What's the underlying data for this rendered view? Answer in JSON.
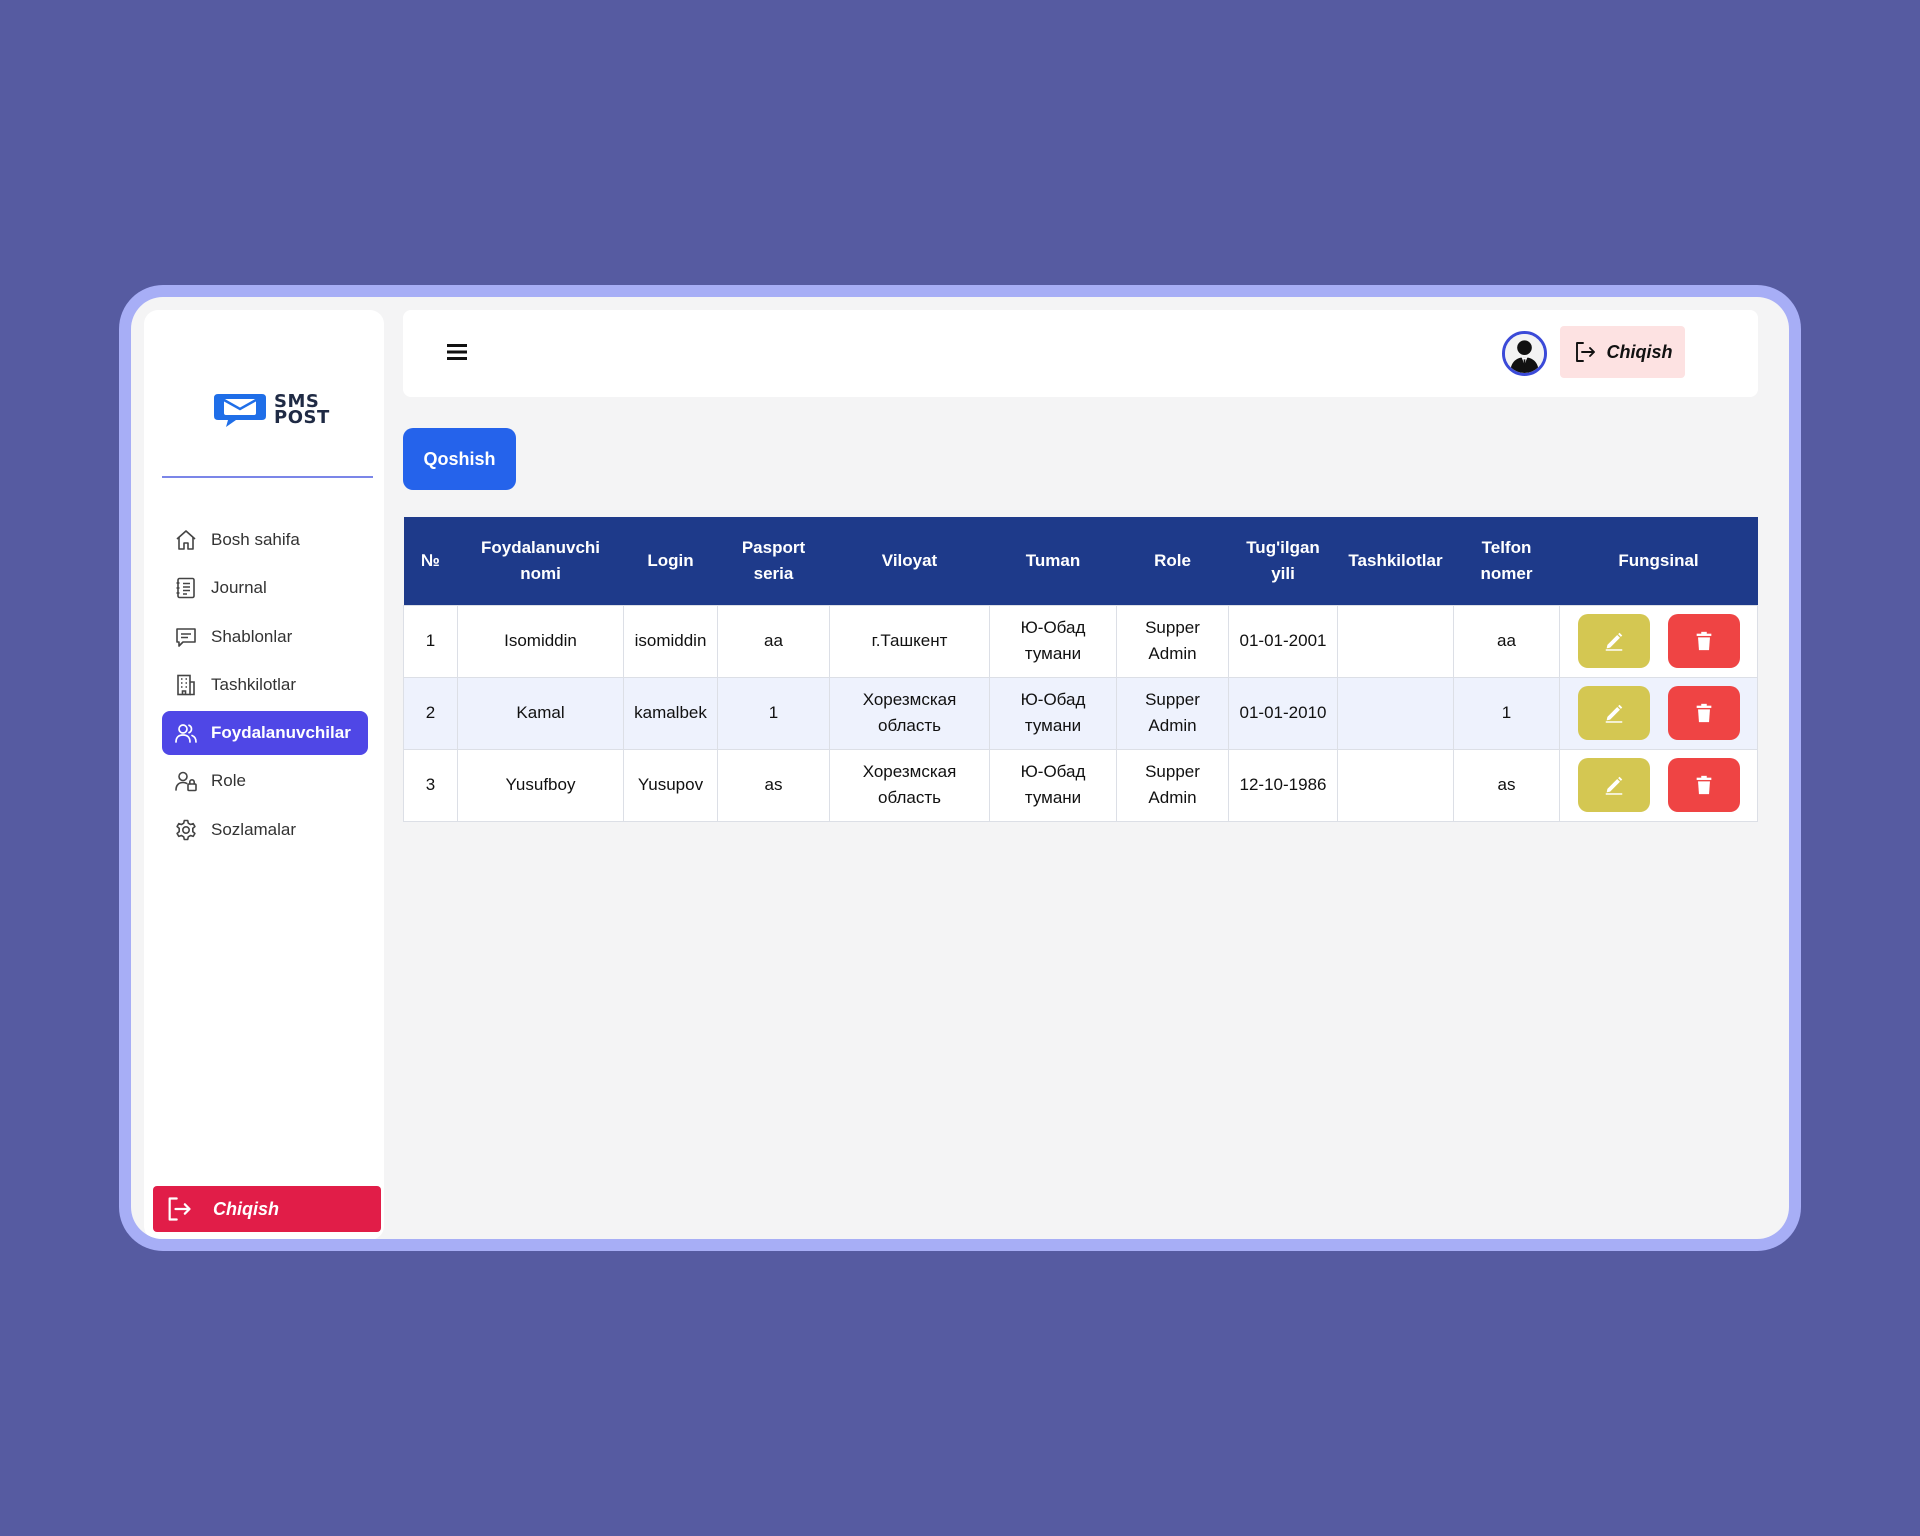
{
  "brand": {
    "line1": "SMS",
    "line2": "POST"
  },
  "sidebar": {
    "items": [
      {
        "label": "Bosh sahifa",
        "icon": "home-icon"
      },
      {
        "label": "Journal",
        "icon": "journal-icon"
      },
      {
        "label": "Shablonlar",
        "icon": "message-icon"
      },
      {
        "label": "Tashkilotlar",
        "icon": "building-icon"
      },
      {
        "label": "Foydalanuvchilar",
        "icon": "users-icon",
        "active": true
      },
      {
        "label": "Role",
        "icon": "user-lock-icon"
      },
      {
        "label": "Sozlamalar",
        "icon": "gear-icon"
      }
    ],
    "logout_label": "Chiqish"
  },
  "topbar": {
    "logout_label": "Chiqish"
  },
  "actions": {
    "add_label": "Qoshish"
  },
  "table": {
    "headers": [
      "№",
      "Foydalanuvchi nomi",
      "Login",
      "Pasport seria",
      "Viloyat",
      "Tuman",
      "Role",
      "Tug'ilgan yili",
      "Tashkilotlar",
      "Telfon nomer",
      "Fungsinal"
    ],
    "rows": [
      {
        "n": "1",
        "name": "Isomiddin",
        "login": "isomiddin",
        "passport": "aa",
        "viloyat": "г.Ташкент",
        "tuman": "Ю-Обад тумани",
        "role": "Supper Admin",
        "birth": "01-01-2001",
        "org": "",
        "phone": "aa"
      },
      {
        "n": "2",
        "name": "Kamal",
        "login": "kamalbek",
        "passport": "1",
        "viloyat": "Хорезмская область",
        "tuman": "Ю-Обад тумани",
        "role": "Supper Admin",
        "birth": "01-01-2010",
        "org": "",
        "phone": "1"
      },
      {
        "n": "3",
        "name": "Yusufboy",
        "login": "Yusupov",
        "passport": "as",
        "viloyat": "Хорезмская область",
        "tuman": "Ю-Обад тумани",
        "role": "Supper Admin",
        "birth": "12-10-1986",
        "org": "",
        "phone": "as"
      }
    ]
  },
  "colors": {
    "background": "#565ba1",
    "frame": "#a7aef6",
    "accent": "#4f47e6",
    "primary_button": "#2563eb",
    "table_header": "#1e3a8a",
    "danger": "#e11d48",
    "edit": "#d4c752",
    "delete": "#ef4444"
  }
}
